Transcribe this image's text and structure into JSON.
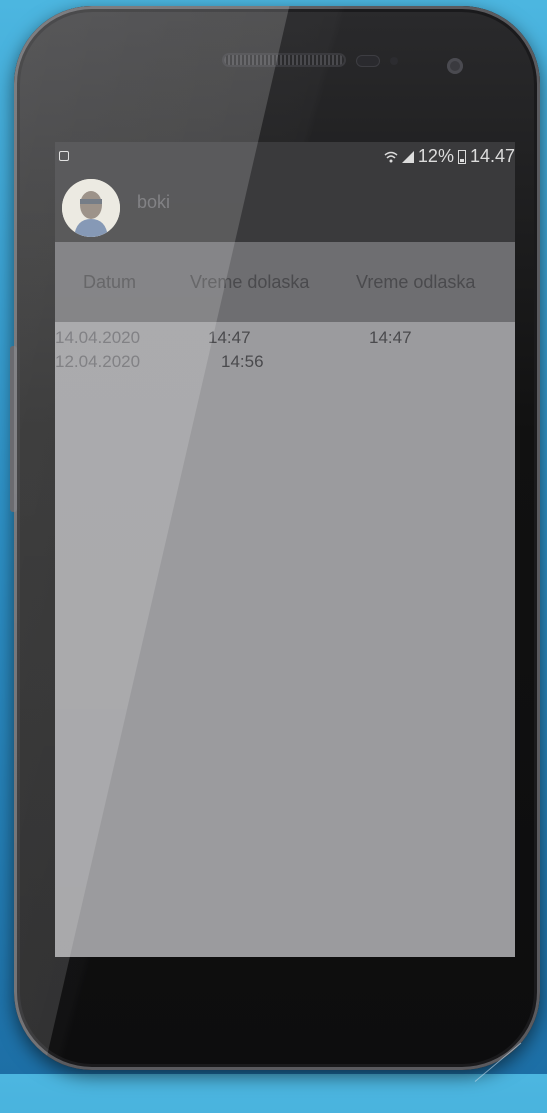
{
  "status_bar": {
    "battery_percent": "12%",
    "time": "14.47",
    "icons": [
      "notification-icon",
      "wifi-icon",
      "signal-icon",
      "battery-icon"
    ]
  },
  "app_bar": {
    "user_name": "boki"
  },
  "table": {
    "headers": [
      "Datum",
      "Vreme dolaska",
      "Vreme odlaska"
    ],
    "rows": [
      {
        "date": "14.04.2020",
        "arrival": "14:47",
        "departure": "14:47"
      },
      {
        "date": "12.04.2020",
        "arrival": "14:56",
        "departure": ""
      }
    ]
  },
  "colors": {
    "status_bar_bg": "#3a3a3c",
    "screen_bg": "#9b9b9e",
    "header_bg": "#6e6e71",
    "background_blue": "#2f93c8"
  }
}
